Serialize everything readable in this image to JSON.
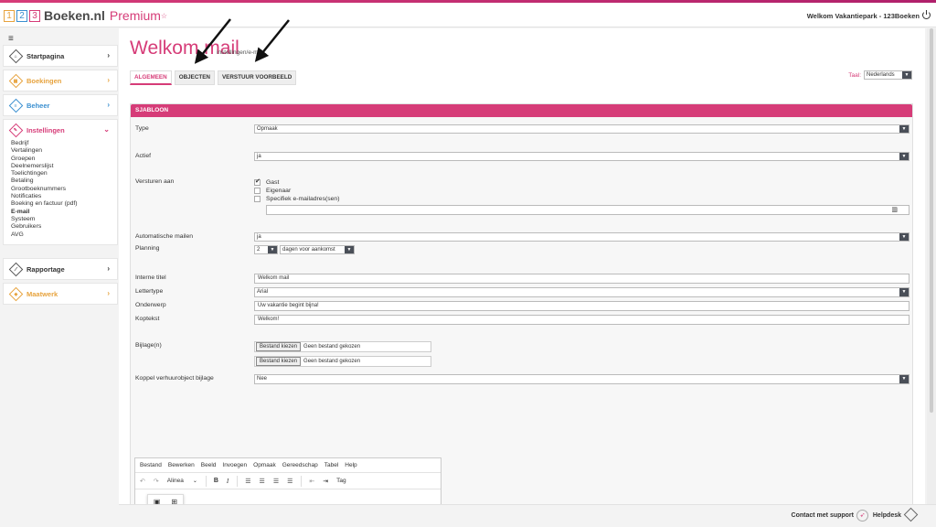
{
  "header": {
    "digits": [
      "1",
      "2",
      "3"
    ],
    "brand": "Boeken.nl",
    "premium": "Premium",
    "premium_star": "☆",
    "welcome": "Welkom Vakantiepark - 123Boeken"
  },
  "sidebar": {
    "menu_icon": "≡",
    "startpagina": "Startpagina",
    "boekingen": "Boekingen",
    "beheer": "Beheer",
    "instellingen": "Instellingen",
    "sub_items": [
      "Bedrijf",
      "Vertalingen",
      "Groepen",
      "Deelnemerslijst",
      "Toelichtingen",
      "Betaling",
      "Grootboeknummers",
      "Notificaties",
      "Boeking en factuur (pdf)",
      "E-mail",
      "Systeem",
      "Gebruikers",
      "AVG"
    ],
    "rapportage": "Rapportage",
    "maatwerk": "Maatwerk",
    "colors": {
      "startpagina": "#555555",
      "boekingen": "#e7a33e",
      "beheer": "#3a8fd0",
      "instellingen": "#d63c78",
      "rapportage": "#555555",
      "maatwerk": "#e7a33e"
    }
  },
  "page": {
    "title": "Welkom mail",
    "subtitle": "instellingen/e-mail",
    "tabs": [
      "ALGEMEEN",
      "OBJECTEN",
      "VERSTUUR VOORBEELD"
    ],
    "lang_label": "Taal:",
    "lang_value": "Nederlands"
  },
  "form": {
    "section": "SJABLOON",
    "type_label": "Type",
    "type_value": "Opmaak",
    "actief_label": "Actief",
    "actief_value": "ja",
    "versturen_label": "Versturen aan",
    "options": [
      "Gast",
      "Eigenaar",
      "Specifiek e-mailadres(sen)"
    ],
    "auto_label": "Automatische mailen",
    "auto_value": "ja",
    "planning_label": "Planning",
    "planning_num": "2",
    "planning_unit": "dagen voor aankomst",
    "interne_label": "Interne titel",
    "interne_value": "Welkom mail",
    "lettertype_label": "Lettertype",
    "lettertype_value": "Arial",
    "onderwerp_label": "Onderwerp",
    "onderwerp_value": "Uw vakantie begint bijna!",
    "koptekst_label": "Koptekst",
    "koptekst_value": "Welkom!",
    "bijlage_label": "Bijlage(n)",
    "file_button": "Bestand kiezen",
    "file_none": "Geen bestand gekozen",
    "koppel_label": "Koppel verhuurobject bijlage",
    "koppel_value": "Nee"
  },
  "editor": {
    "menu": [
      "Bestand",
      "Bewerken",
      "Beeld",
      "Invoegen",
      "Opmaak",
      "Gereedschap",
      "Tabel",
      "Help"
    ],
    "format": "Alinea",
    "tag": "Tag"
  },
  "footer": {
    "support": "Contact met support",
    "helpdesk": "Helpdesk"
  }
}
